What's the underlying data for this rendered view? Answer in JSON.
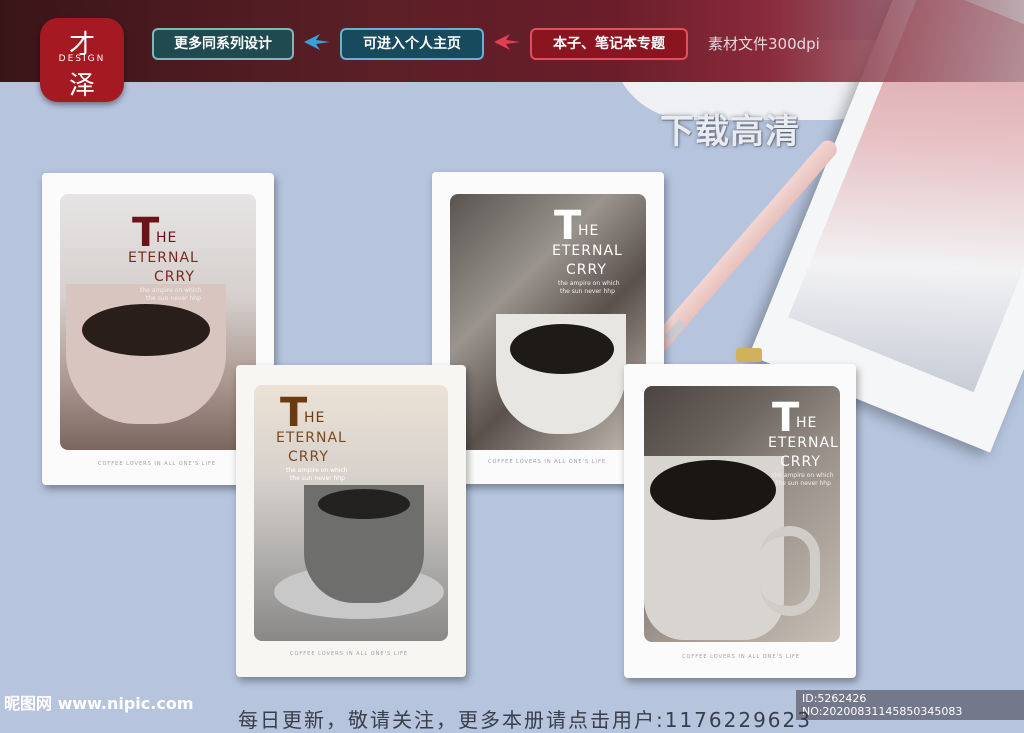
{
  "logo": {
    "top_char": "才",
    "word": "DESIGN",
    "bottom_char": "泽"
  },
  "nav": {
    "button1": "更多同系列设计",
    "button2": "可进入个人主页",
    "button3": "本子、笔记本专题",
    "resolution": "素材文件300dpi"
  },
  "download_label": "下载高清",
  "notebooks": [
    {
      "big": "T",
      "rest1": "HE",
      "rest2": "ETERNAL",
      "rest3": "CRRY",
      "sub1": "the ampire on which",
      "sub2": "the sun never hhp",
      "foot": "COFFEE LOVERS IN ALL ONE'S LIFE"
    },
    {
      "big": "T",
      "rest1": "HE",
      "rest2": "ETERNAL",
      "rest3": "CRRY",
      "sub1": "the ampire on which",
      "sub2": "the sun never hhp",
      "foot": "COFFEE LOVERS IN ALL ONE'S LIFE"
    },
    {
      "big": "T",
      "rest1": "HE",
      "rest2": "ETERNAL",
      "rest3": "CRRY",
      "sub1": "the ampire on which",
      "sub2": "the sun never hhp",
      "foot": "COFFEE LOVERS IN ALL ONE'S LIFE"
    },
    {
      "big": "T",
      "rest1": "HE",
      "rest2": "ETERNAL",
      "rest3": "CRRY",
      "sub1": "the ampire on which",
      "sub2": "the sun never hhp",
      "foot": "COFFEE LOVERS IN ALL ONE'S LIFE"
    }
  ],
  "footer": {
    "site": "昵图网 www.nipic.com",
    "id_info": "ID:5262426 NO:20200831145850345083",
    "ticker": "每日更新，敬请关注，更多本册请点击用户:1176229623"
  },
  "colors": {
    "brand_red": "#a51a22",
    "title_brown": "#6a2a1a",
    "title_white": "#ffffff"
  }
}
